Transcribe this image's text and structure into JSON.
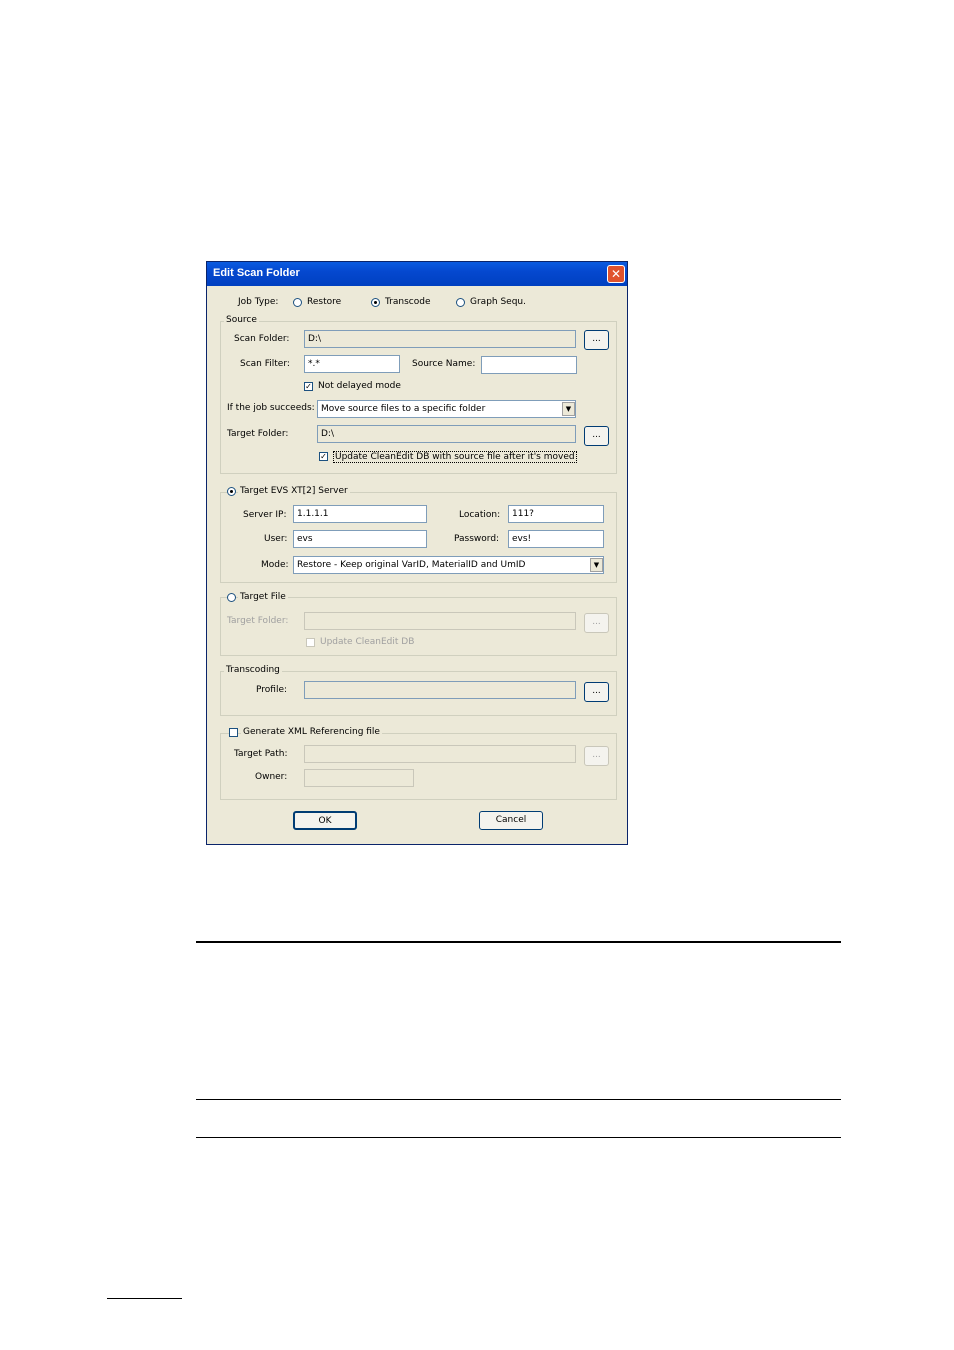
{
  "dialog": {
    "title": "Edit Scan Folder",
    "close_glyph": "✕",
    "job_type": {
      "label": "Job Type:",
      "options": [
        "Restore",
        "Transcode",
        "Graph Sequ."
      ],
      "selected": "Transcode"
    },
    "source": {
      "legend": "Source",
      "scan_folder_label": "Scan Folder:",
      "scan_folder_value": "D:\\",
      "browse_label": "...",
      "scan_filter_label": "Scan Filter:",
      "scan_filter_value": "*.*",
      "source_name_label": "Source Name:",
      "source_name_value": "",
      "not_delayed_label": "Not delayed mode",
      "not_delayed_checked": true,
      "if_succeeds_label": "If the job succeeds:",
      "if_succeeds_value": "Move source files to a specific folder",
      "target_folder_label": "Target Folder:",
      "target_folder_value": "D:\\",
      "update_db_label": "Update CleanEdit DB with source file after it's moved",
      "update_db_checked": true
    },
    "target_server": {
      "legend": "Target EVS XT[2] Server",
      "selected": true,
      "server_ip_label": "Server IP:",
      "server_ip_value": "1.1.1.1",
      "location_label": "Location:",
      "location_value": "111?",
      "user_label": "User:",
      "user_value": "evs",
      "password_label": "Password:",
      "password_value": "evs!",
      "mode_label": "Mode:",
      "mode_value": "Restore - Keep original VarID, MaterialID and UmID"
    },
    "target_file": {
      "legend": "Target File",
      "selected": false,
      "target_folder_label": "Target Folder:",
      "target_folder_value": "",
      "update_db_label": "Update CleanEdit DB"
    },
    "transcoding": {
      "legend": "Transcoding",
      "profile_label": "Profile:",
      "profile_value": ""
    },
    "xml": {
      "legend": "Generate XML Referencing file",
      "checked": false,
      "target_path_label": "Target Path:",
      "target_path_value": "",
      "owner_label": "Owner:",
      "owner_value": ""
    },
    "ok_label": "OK",
    "cancel_label": "Cancel"
  }
}
